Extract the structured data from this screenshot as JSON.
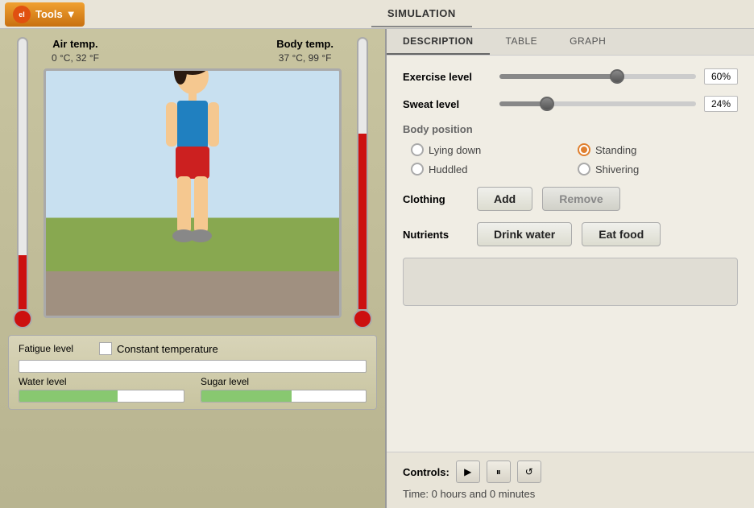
{
  "app": {
    "logo_text": "el",
    "tools_label": "Tools"
  },
  "tabs": {
    "main": [
      {
        "id": "simulation",
        "label": "SIMULATION",
        "active": true
      }
    ],
    "right": [
      {
        "id": "description",
        "label": "DESCRIPTION",
        "active": true
      },
      {
        "id": "table",
        "label": "TABLE",
        "active": false
      },
      {
        "id": "graph",
        "label": "GRAPH",
        "active": false
      }
    ]
  },
  "left": {
    "air_temp_label": "Air temp.",
    "air_temp_value": "0 °C, 32 °F",
    "body_temp_label": "Body temp.",
    "body_temp_value": "37 °C, 99 °F",
    "fatigue_label": "Fatigue level",
    "water_label": "Water level",
    "sugar_label": "Sugar level",
    "constant_temp_label": "Constant temperature"
  },
  "description": {
    "exercise_label": "Exercise level",
    "exercise_value": "60%",
    "exercise_percent": 60,
    "sweat_label": "Sweat level",
    "sweat_value": "24%",
    "sweat_percent": 24,
    "body_position_label": "Body position",
    "positions": [
      {
        "id": "lying_down",
        "label": "Lying down",
        "checked": false
      },
      {
        "id": "standing",
        "label": "Standing",
        "checked": true
      },
      {
        "id": "huddled",
        "label": "Huddled",
        "checked": false
      },
      {
        "id": "shivering",
        "label": "Shivering",
        "checked": false
      }
    ],
    "clothing_label": "Clothing",
    "add_label": "Add",
    "remove_label": "Remove",
    "nutrients_label": "Nutrients",
    "drink_water_label": "Drink water",
    "eat_food_label": "Eat food"
  },
  "controls": {
    "label": "Controls:",
    "play_icon": "▶",
    "pause_icon": "⏸",
    "reset_icon": "↺",
    "time_label": "Time: 0 hours and 0 minutes"
  }
}
